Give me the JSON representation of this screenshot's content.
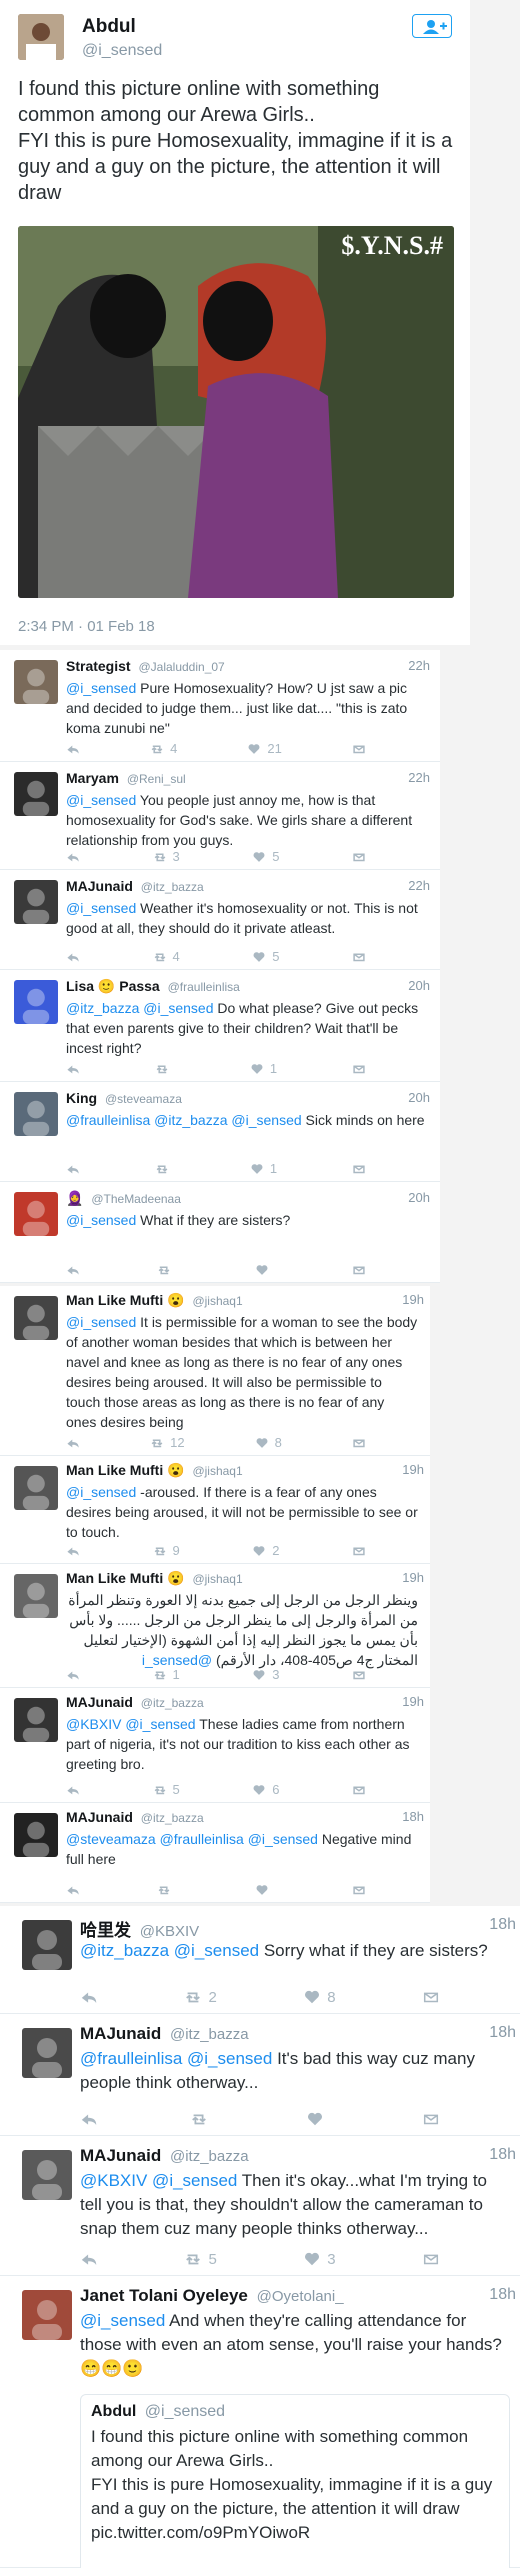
{
  "main_tweet": {
    "name": "Abdul",
    "handle": "@i_sensed",
    "text": "I found this picture online with something common among our Arewa Girls..\nFYI this is pure Homosexuality, immagine if it is a guy and a guy on the picture, the attention it will draw",
    "photo_watermark": "$.Y.N.S.#",
    "timestamp": "2:34 PM · 01 Feb 18"
  },
  "section1_replies": [
    {
      "name": "Strategist",
      "handle": "@Jalaluddin_07",
      "time": "22h",
      "parts": [
        {
          "t": "@i_sensed",
          "m": true
        },
        {
          "t": " Pure Homosexuality? How? U jst saw a pic and decided to judge them... just like dat.... \"this is zato koma zunubi ne\""
        }
      ],
      "rt": "4",
      "likes": "21"
    },
    {
      "name": "Maryam",
      "handle": "@Reni_sul",
      "time": "22h",
      "parts": [
        {
          "t": "@i_sensed",
          "m": true
        },
        {
          "t": " You people just annoy me, how is that homosexuality for God's sake. We girls share a different relationship from you guys."
        }
      ],
      "rt": "3",
      "likes": "5"
    },
    {
      "name": "MAJunaid",
      "handle": "@itz_bazza",
      "time": "22h",
      "parts": [
        {
          "t": "@i_sensed",
          "m": true
        },
        {
          "t": " Weather it's homosexuality or not. This is not good at all, they should do it private atleast."
        }
      ],
      "rt": "4",
      "likes": "5"
    },
    {
      "name": "Lisa 🙂 Passa",
      "handle": "@fraulleinlisa",
      "time": "20h",
      "parts": [
        {
          "t": "@itz_bazza @i_sensed",
          "m": true
        },
        {
          "t": " Do what please? Give out pecks that even parents give to their children?  Wait that'll be incest right?"
        }
      ],
      "rt": "",
      "likes": "1"
    },
    {
      "name": "King",
      "handle": "@steveamaza",
      "time": "20h",
      "parts": [
        {
          "t": "@fraulleinlisa @itz_bazza @i_sensed",
          "m": true
        },
        {
          "t": " Sick minds on here"
        }
      ],
      "rt": "",
      "likes": "1"
    },
    {
      "name": "🧕",
      "handle": "@TheMadeenaa",
      "time": "20h",
      "parts": [
        {
          "t": "@i_sensed",
          "m": true
        },
        {
          "t": " What if they are sisters?"
        }
      ],
      "rt": "",
      "likes": ""
    }
  ],
  "section2_replies": [
    {
      "name": "Man Like Mufti 😮",
      "handle": "@jishaq1",
      "time": "19h",
      "parts": [
        {
          "t": "@i_sensed",
          "m": true
        },
        {
          "t": " It is permissible for a woman to see the body of another woman besides that which is between her navel and knee as long as there is no fear of any ones desires being aroused. It will also be permissible to touch those areas as long as there is no fear of any ones desires being"
        }
      ],
      "rt": "12",
      "likes": "8"
    },
    {
      "name": "Man Like Mufti 😮",
      "handle": "@jishaq1",
      "time": "19h",
      "parts": [
        {
          "t": "@i_sensed",
          "m": true
        },
        {
          "t": " -aroused. If there is a fear of any ones desires being aroused, it will not be permissible to see or to touch."
        }
      ],
      "rt": "9",
      "likes": "2"
    },
    {
      "name": "Man Like Mufti 😮",
      "handle": "@jishaq1",
      "time": "19h",
      "parts": [
        {
          "t": "وينظر الرجل من الرجل إلى جميع بدنه إلا العورة وتنظر المرأة من المرأة والرجل إلى ما ينظر الرجل من الرجل ...... ولا بأس بأن يمس ما يجوز النظر إليه إذا أمن الشهوة (الإختيار لتعليل المختار ج4 ص405-408، دار الأرقم) "
        },
        {
          "t": "@i_sensed",
          "m": true
        }
      ],
      "rt": "1",
      "likes": "3"
    },
    {
      "name": "MAJunaid",
      "handle": "@itz_bazza",
      "time": "19h",
      "parts": [
        {
          "t": "@KBXIV @i_sensed",
          "m": true
        },
        {
          "t": " These ladies came from northern part of nigeria, it's not our tradition to kiss each other as greeting bro."
        }
      ],
      "rt": "5",
      "likes": "6"
    },
    {
      "name": "MAJunaid",
      "handle": "@itz_bazza",
      "time": "18h",
      "parts": [
        {
          "t": "@steveamaza @fraulleinlisa @i_sensed",
          "m": true
        },
        {
          "t": " Negative mind full here"
        }
      ],
      "rt": "",
      "likes": ""
    }
  ],
  "section3_replies": [
    {
      "name": "哈里发",
      "handle": "@KBXIV",
      "time": "18h",
      "parts": [
        {
          "t": "@itz_bazza @i_sensed",
          "m": true
        },
        {
          "t": " Sorry what if they are sisters?"
        }
      ],
      "rt": "2",
      "likes": "8"
    },
    {
      "name": "MAJunaid",
      "handle": "@itz_bazza",
      "time": "18h",
      "parts": [
        {
          "t": "@fraulleinlisa @i_sensed",
          "m": true
        },
        {
          "t": " It's bad this way cuz many people think otherway..."
        }
      ],
      "rt": "",
      "likes": ""
    },
    {
      "name": "MAJunaid",
      "handle": "@itz_bazza",
      "time": "18h",
      "parts": [
        {
          "t": "@KBXIV @i_sensed",
          "m": true
        },
        {
          "t": " Then it's okay...what I'm trying to tell you is that, they shouldn't allow the cameraman to snap them cuz many people thinks otherway..."
        }
      ],
      "rt": "5",
      "likes": "3"
    },
    {
      "name": "Janet Tolani Oyeleye",
      "handle": "@Oyetolani_",
      "time": "18h",
      "parts": [
        {
          "t": "@i_sensed",
          "m": true
        },
        {
          "t": " And when they're calling attendance for those with even an atom sense, you'll raise your hands? 😁😁🙂"
        }
      ],
      "rt": "",
      "likes": ""
    }
  ],
  "quoted_tweet": {
    "name": "Abdul",
    "handle": "@i_sensed",
    "text": "I found this picture online with something common among our Arewa Girls..\nFYI this is pure Homosexuality, immagine if it is a guy and a guy on the picture, the attention it will draw pic.twitter.com/o9PmYOiwoR"
  },
  "colors": {
    "mention": "#1d8dee",
    "muted": "#8899a6",
    "icon": "#aab8c2",
    "follow": "#1da1f2"
  }
}
